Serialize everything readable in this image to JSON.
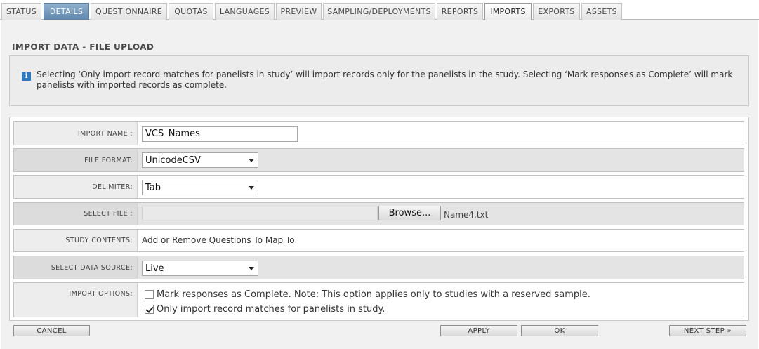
{
  "tabs": [
    {
      "label": "STATUS"
    },
    {
      "label": "DETAILS"
    },
    {
      "label": "QUESTIONNAIRE"
    },
    {
      "label": "QUOTAS"
    },
    {
      "label": "LANGUAGES"
    },
    {
      "label": "PREVIEW"
    },
    {
      "label": "SAMPLING/DEPLOYMENTS"
    },
    {
      "label": "REPORTS"
    },
    {
      "label": "IMPORTS"
    },
    {
      "label": "EXPORTS"
    },
    {
      "label": "ASSETS"
    }
  ],
  "page": {
    "title": "IMPORT DATA - FILE UPLOAD",
    "info_icon": "info-icon",
    "info_text": "Selecting ‘Only import record matches for panelists in study’ will import records only for the panelists in the study. Selecting ‘Mark responses as Complete’ will mark panelists with imported records as complete."
  },
  "form": {
    "import_name": {
      "label": "IMPORT NAME :",
      "value": "VCS_Names"
    },
    "file_format": {
      "label": "FILE FORMAT:",
      "value": "UnicodeCSV"
    },
    "delimiter": {
      "label": "DELIMITER:",
      "value": "Tab"
    },
    "select_file": {
      "label": "SELECT FILE :",
      "browse_label": "Browse...",
      "file_name": "Name4.txt"
    },
    "study_contents": {
      "label": "STUDY CONTENTS:",
      "link": "Add or Remove Questions To Map To"
    },
    "data_source": {
      "label": "SELECT DATA SOURCE:",
      "value": "Live"
    },
    "import_options": {
      "label": "IMPORT OPTIONS:",
      "mark_complete": {
        "label": "Mark responses as Complete. Note: This option applies only to studies with a reserved sample.",
        "checked": false
      },
      "only_matches": {
        "label": "Only import record matches for panelists in study.",
        "checked": true
      }
    }
  },
  "buttons": {
    "cancel": "CANCEL",
    "apply": "APPLY",
    "ok": "OK",
    "next_step": "NEXT STEP »"
  },
  "colors": {
    "selected_tab": "#6f96bb",
    "info_icon": "#2e78c2",
    "panel_bg": "#f1f1f1"
  }
}
